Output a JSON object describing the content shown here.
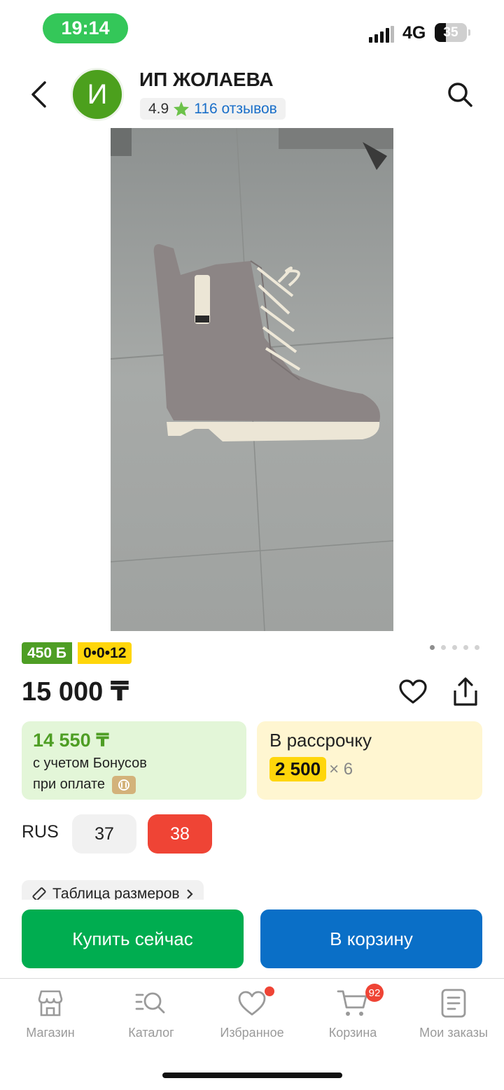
{
  "status_bar": {
    "time": "19:14",
    "network": "4G",
    "battery": "35",
    "battery_level": 0.35
  },
  "header": {
    "avatar_letter": "И",
    "store_name": "ИП ЖОЛАЕВА",
    "rating": "4.9",
    "reviews": "116 отзывов"
  },
  "gallery": {
    "image_count": 5,
    "active_index": 0
  },
  "badges": {
    "bonus": "450 Б",
    "installment": "0•0•12"
  },
  "price": "15 000 ₸",
  "bonus_offer": {
    "price": "14 550 ₸",
    "line1": "с учетом Бонусов",
    "line2": "при оплате"
  },
  "credit_offer": {
    "title": "В рассрочку",
    "amount": "2 500",
    "times": "× 6"
  },
  "sizes": {
    "system": "RUS",
    "options": [
      "37",
      "38"
    ],
    "selected": "38"
  },
  "size_table": "Таблица размеров",
  "actions": {
    "buy_now": "Купить сейчас",
    "add_to_cart": "В корзину"
  },
  "nav": {
    "shop": "Магазин",
    "catalog": "Каталог",
    "favorites": "Избранное",
    "cart": "Корзина",
    "cart_count": "92",
    "orders": "Мои заказы"
  },
  "colors": {
    "green": "#00ad50",
    "blue": "#0a6fc7",
    "red": "#ef4435",
    "yellow": "#ffd60a",
    "bonus_green": "#4e9e24"
  }
}
